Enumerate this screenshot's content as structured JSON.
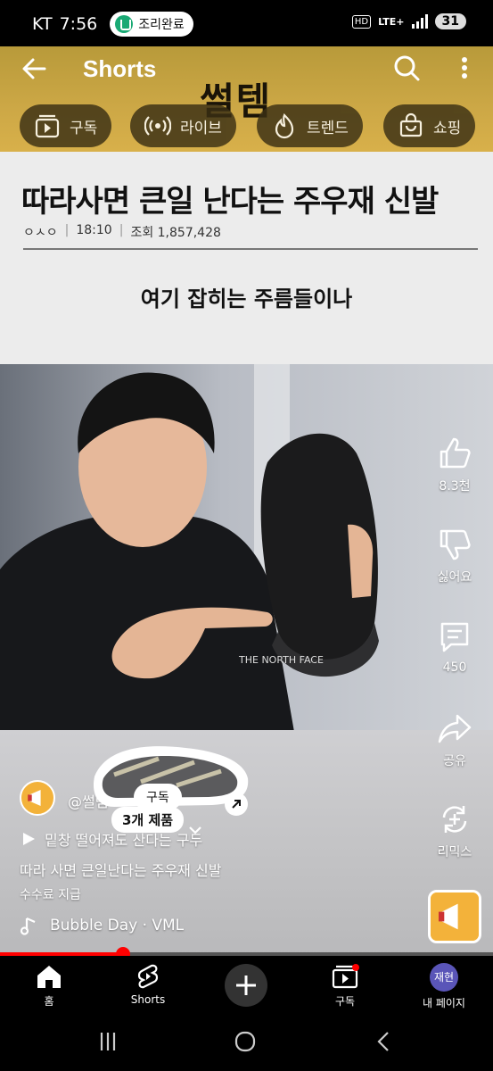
{
  "status_bar": {
    "carrier": "KT",
    "time": "7:56",
    "notification": "조리완료",
    "hd": "HD",
    "network": "LTE+",
    "battery": "31"
  },
  "header": {
    "title": "Shorts",
    "channel_watermark": "썰템",
    "chips": [
      {
        "label": "구독",
        "icon": "subscriptions-icon"
      },
      {
        "label": "라이브",
        "icon": "live-icon"
      },
      {
        "label": "트렌드",
        "icon": "trending-icon"
      },
      {
        "label": "쇼핑",
        "icon": "shopping-bag-icon"
      }
    ]
  },
  "video": {
    "article_title": "따라사면 큰일 난다는 주우재 신발",
    "article_author": "ㅇㅅㅇ",
    "article_time": "18:10",
    "article_views": "조회 1,857,428",
    "subtitle": "여기 잡히는 주름들이나",
    "channel_handle": "@썰템",
    "subscribe_label": "구독",
    "product_count": "3개 제품",
    "playlist_text": "밑창 떨어져도 산다는 구두",
    "caption": "따라 사면 큰일난다는 주우재 신발",
    "sponsored": "수수료 지급",
    "music": "Bubble Day · VML",
    "progress": 0.25
  },
  "actions": {
    "like": "8.3천",
    "dislike": "싫어요",
    "comments": "450",
    "share": "공유",
    "remix": "리믹스"
  },
  "bottom_nav": {
    "home": "홈",
    "shorts": "Shorts",
    "subscriptions": "구독",
    "profile": "내 페이지",
    "profile_initials": "재현"
  },
  "colors": {
    "header_gold": "#cda846",
    "accent_red": "#ff0000",
    "chip_dark": "#3a2f14"
  }
}
